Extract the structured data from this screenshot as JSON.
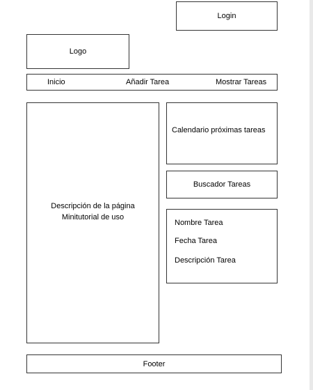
{
  "header": {
    "login_label": "Login",
    "logo_label": "Logo"
  },
  "nav": {
    "items": [
      {
        "label": "Inicio"
      },
      {
        "label": "Añadir Tarea"
      },
      {
        "label": "Mostrar Tareas"
      }
    ]
  },
  "main": {
    "description_line1": "Descripción de la página",
    "description_line2": "Minitutorial de uso"
  },
  "sidebar": {
    "calendar_label": "Calendario próximas tareas",
    "search_label": "Buscador Tareas",
    "task_fields": [
      {
        "label": "Nombre Tarea"
      },
      {
        "label": "Fecha Tarea"
      },
      {
        "label": "Descripción Tarea"
      }
    ]
  },
  "footer": {
    "label": "Footer"
  }
}
